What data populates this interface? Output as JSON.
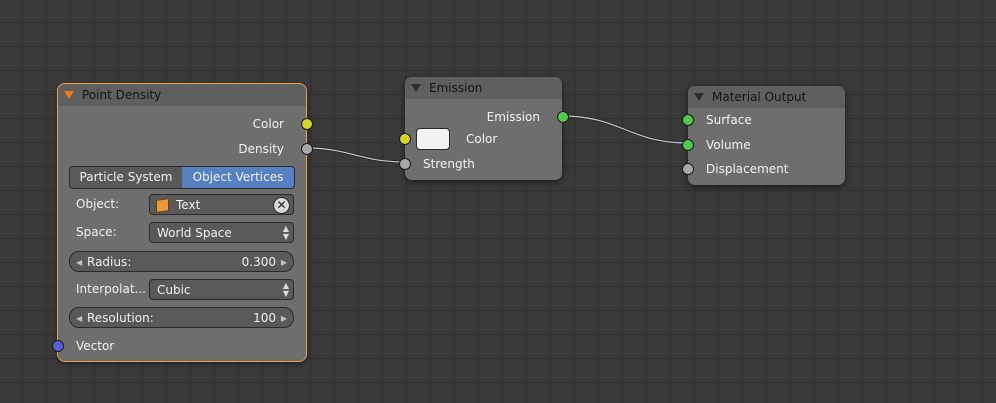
{
  "colors": {
    "socket_color": "#d4d42e",
    "socket_float": "#a8a8a8",
    "socket_shader": "#50c850",
    "socket_vector": "#5c5cd8",
    "accent_active": "#5680c2",
    "selected_outline": "#f0a048"
  },
  "point_density": {
    "title": "Point Density",
    "output_color": "Color",
    "output_density": "Density",
    "tabs": [
      "Particle System",
      "Object Vertices"
    ],
    "active_tab": "Object Vertices",
    "object_label": "Object:",
    "object_value": "Text",
    "object_icon": "cube-icon",
    "space_label": "Space:",
    "space_value": "World Space",
    "radius_label": "Radius:",
    "radius_value": "0.300",
    "interpolation_label": "Interpolat...",
    "interpolation_value": "Cubic",
    "resolution_label": "Resolution:",
    "resolution_value": "100",
    "input_vector": "Vector"
  },
  "emission": {
    "title": "Emission",
    "output_emission": "Emission",
    "input_color": "Color",
    "color_value": "#f2f2f2",
    "input_strength": "Strength"
  },
  "material_output": {
    "title": "Material Output",
    "input_surface": "Surface",
    "input_volume": "Volume",
    "input_displacement": "Displacement"
  }
}
